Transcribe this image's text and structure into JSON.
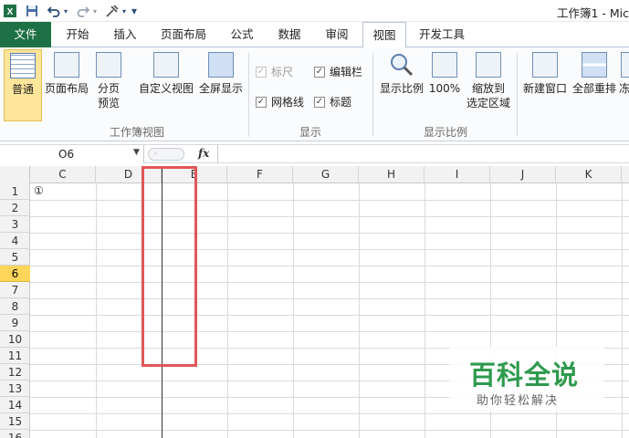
{
  "title": "工作簿1 - Mic",
  "quick_access": {
    "more": "▾"
  },
  "tabs": [
    "文件",
    "开始",
    "插入",
    "页面布局",
    "公式",
    "数据",
    "审阅",
    "视图",
    "开发工具"
  ],
  "active_tab": "视图",
  "ribbon": {
    "workbook_views": {
      "label": "工作簿视图",
      "normal": "普通",
      "page_layout": "页面布局",
      "page_break_1": "分页",
      "page_break_2": "预览",
      "custom_view": "自定义视图",
      "full_screen": "全屏显示"
    },
    "show": {
      "label": "显示",
      "ruler": "标尺",
      "formula_bar": "编辑栏",
      "gridlines": "网格线",
      "headings": "标题"
    },
    "zoom": {
      "label": "显示比例",
      "zoom": "显示比例",
      "hundred": "100%",
      "to_sel_1": "缩放到",
      "to_sel_2": "选定区域"
    },
    "window": {
      "new_window": "新建窗口",
      "arrange_all": "全部重排",
      "freeze": "冻"
    }
  },
  "formula_bar": {
    "name_box": "O6",
    "fx": "fx",
    "value": ""
  },
  "columns": [
    "C",
    "D",
    "E",
    "F",
    "G",
    "H",
    "I",
    "J",
    "K"
  ],
  "rows": [
    "1",
    "2",
    "3",
    "4",
    "5",
    "6",
    "7",
    "8",
    "9",
    "10",
    "11",
    "12",
    "13",
    "14",
    "15",
    "16"
  ],
  "selected_row": "6",
  "cells": {
    "C1": "①"
  },
  "watermark": {
    "title": "百科全说",
    "subtitle": "助你轻松解决"
  },
  "colors": {
    "file_tab": "#1e7145",
    "selected_header": "#ffd65a",
    "highlight_box": "#e05757",
    "watermark": "#2e9a4e"
  }
}
